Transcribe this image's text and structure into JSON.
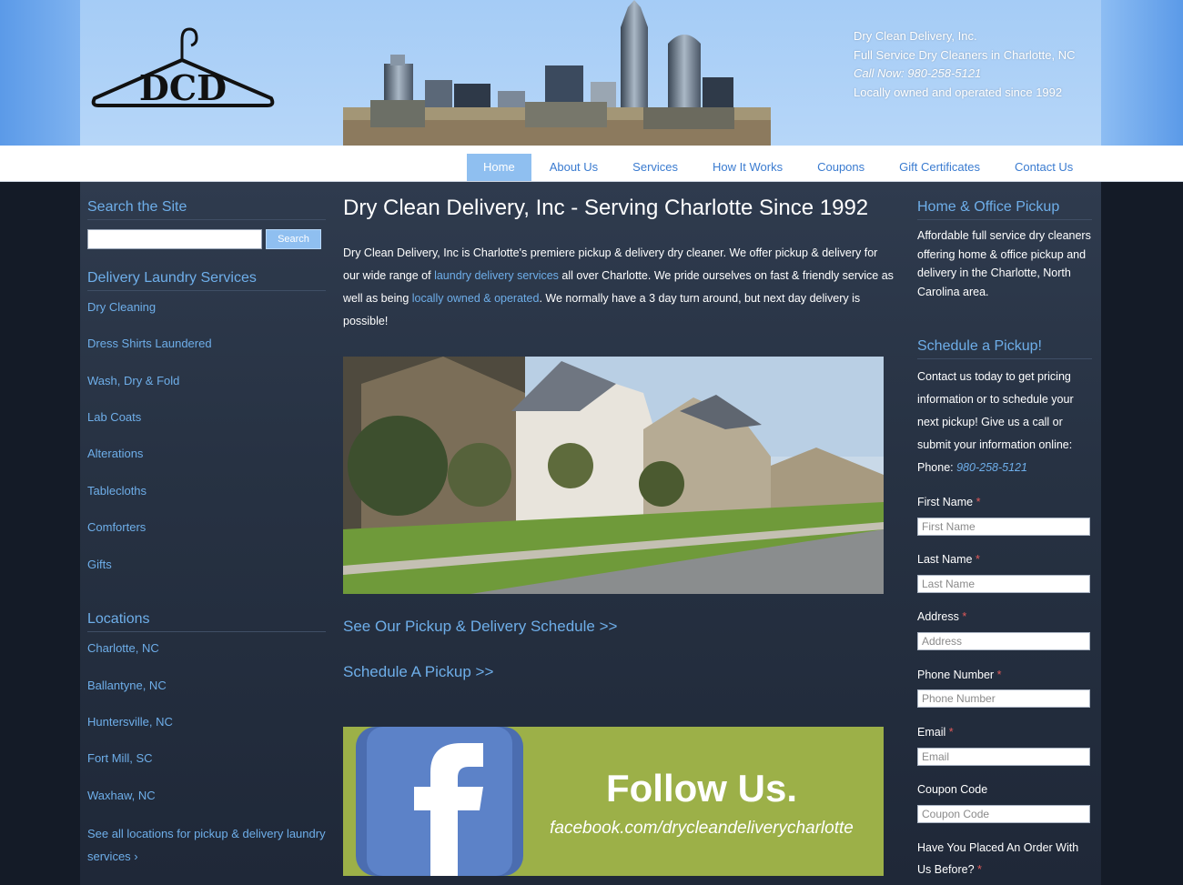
{
  "header": {
    "logo_text": "DCD",
    "company": "Dry Clean Delivery, Inc.",
    "tagline": "Full Service Dry Cleaners in Charlotte, NC",
    "call": "Call Now: 980-258-5121",
    "since": "Locally owned and operated since 1992"
  },
  "nav": {
    "items": [
      {
        "label": "Home"
      },
      {
        "label": "About Us"
      },
      {
        "label": "Services"
      },
      {
        "label": "How It Works"
      },
      {
        "label": "Coupons"
      },
      {
        "label": "Gift Certificates"
      },
      {
        "label": "Contact Us"
      }
    ]
  },
  "left": {
    "search_heading": "Search the Site",
    "search_button": "Search",
    "services_heading": "Delivery Laundry Services",
    "services": [
      "Dry Cleaning",
      "Dress Shirts Laundered",
      "Wash, Dry & Fold",
      "Lab Coats",
      "Alterations",
      "Tablecloths",
      "Comforters",
      "Gifts"
    ],
    "locations_heading": "Locations",
    "locations": [
      "Charlotte, NC",
      "Ballantyne, NC",
      "Huntersville, NC",
      "Fort Mill, SC",
      "Waxhaw, NC"
    ],
    "all_locations": "See all locations for pickup & delivery laundry services ›"
  },
  "main": {
    "title": "Dry Clean Delivery, Inc - Serving Charlotte Since 1992",
    "intro_1": "Dry Clean Delivery, Inc is Charlotte's premiere pickup & delivery dry cleaner. We offer pickup & delivery for our wide range of ",
    "intro_link_1": "laundry delivery services",
    "intro_2": " all over Charlotte. We pride ourselves on fast & friendly service as well as being ",
    "intro_link_2": "locally owned & operated",
    "intro_3": ". We normally have a 3 day turn around, but next day delivery is possible!",
    "cta_schedule": "See Our Pickup & Delivery Schedule >>",
    "cta_pickup": "Schedule A Pickup >>",
    "fb_follow": "Follow Us.",
    "fb_url": "facebook.com/drycleandeliverycharlotte"
  },
  "right": {
    "pickup_heading": "Home & Office Pickup",
    "pickup_text": "Affordable full service dry cleaners offering home & office pickup and delivery in the Charlotte, North Carolina area.",
    "schedule_heading": "Schedule a Pickup!",
    "schedule_text": "Contact us today to get pricing information or to schedule your next pickup! Give us a call or submit your information online:",
    "phone_label": "Phone: ",
    "phone": "980-258-5121",
    "form": {
      "first_name_label": "First Name",
      "first_name_placeholder": "First Name",
      "last_name_label": "Last Name",
      "last_name_placeholder": "Last Name",
      "address_label": "Address",
      "address_placeholder": "Address",
      "phone_label": "Phone Number",
      "phone_placeholder": "Phone Number",
      "email_label": "Email",
      "email_placeholder": "Email",
      "coupon_label": "Coupon Code",
      "coupon_placeholder": "Coupon Code",
      "prior_order_label": "Have You Placed An Order With Us Before?",
      "required_mark": "*"
    }
  },
  "colors": {
    "accent": "#6eaee9",
    "nav_active": "#8fbff0",
    "background": "#1b2332",
    "facebook_green": "#9cb048",
    "facebook_blue": "#3b5998"
  }
}
